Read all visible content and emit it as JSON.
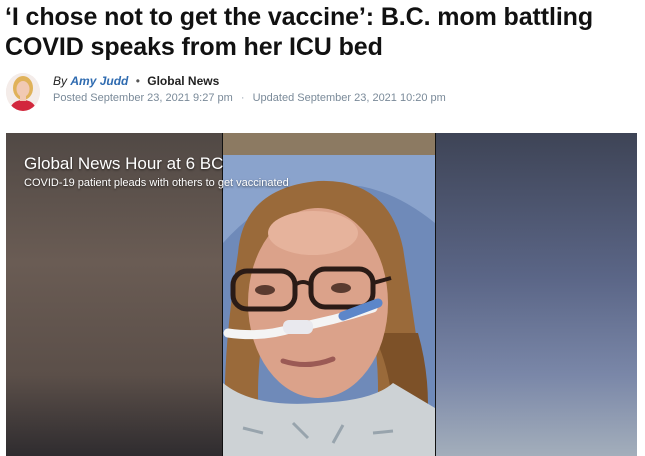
{
  "article": {
    "headline": "‘I chose not to get the vaccine’: B.C. mom battling COVID speaks from her ICU bed"
  },
  "byline": {
    "by_prefix": "By",
    "author": "Amy Judd",
    "separator": "•",
    "outlet": "Global News",
    "posted": "Posted September 23, 2021 9:27 pm",
    "date_separator": "·",
    "updated": "Updated September 23, 2021 10:20 pm"
  },
  "video": {
    "show_title": "Global News Hour at 6 BC",
    "caption": "COVID-19 patient pleads with others to get vaccinated"
  },
  "colors": {
    "author_link": "#2f6bb0",
    "meta_text": "#7a8a99"
  }
}
